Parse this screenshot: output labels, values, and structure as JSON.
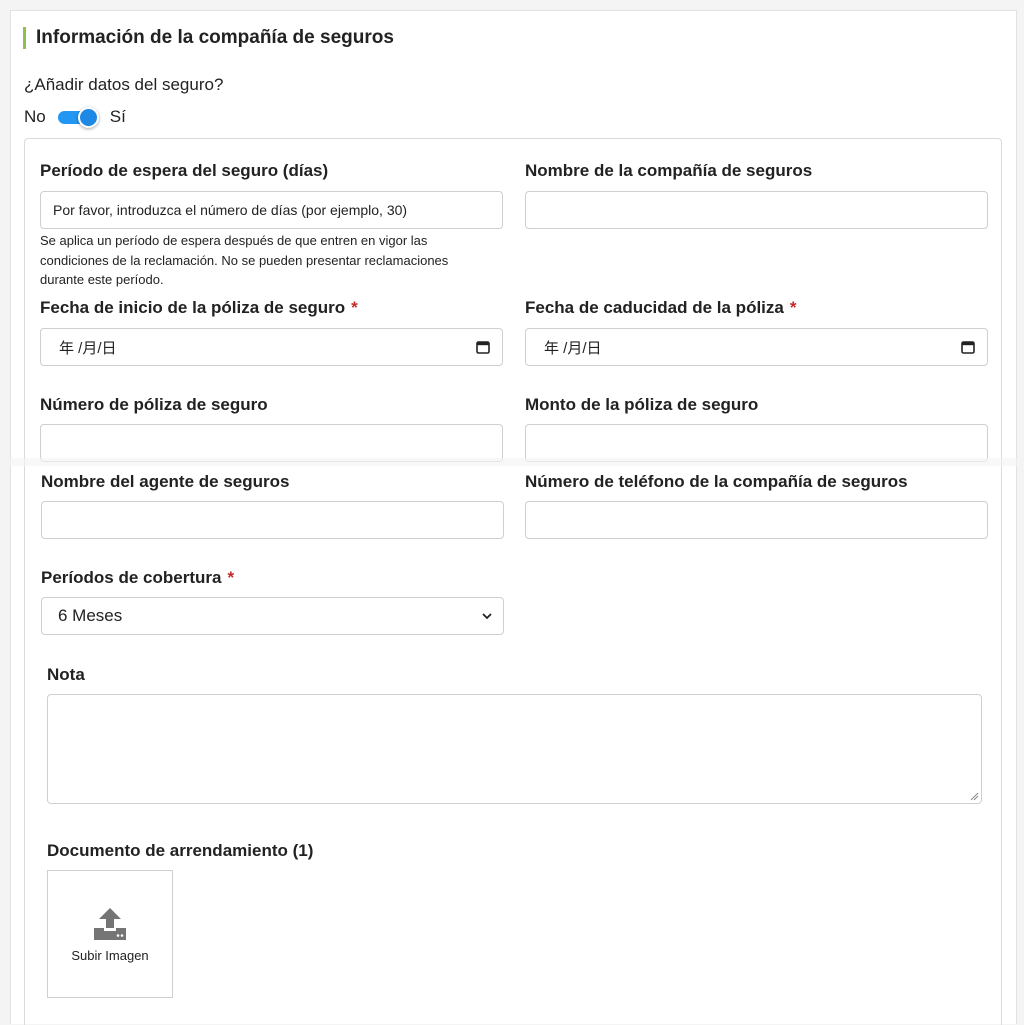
{
  "section": {
    "title": "Información de la compañía de seguros"
  },
  "toggle": {
    "question": "¿Añadir datos del seguro?",
    "off_label": "No",
    "on_label": "Sí",
    "state": "on"
  },
  "fields": {
    "waiting_period": {
      "label": "Período de espera del seguro (días)",
      "placeholder": "Por favor, introduzca el número de días (por ejemplo, 30)",
      "help": "Se aplica un período de espera después de que entren en vigor las condiciones de la reclamación. No se pueden presentar reclamaciones durante este período."
    },
    "company_name": {
      "label": "Nombre de la compañía de seguros",
      "value": ""
    },
    "start_date": {
      "label": "Fecha de inicio de la póliza de seguro",
      "required": "*",
      "mask": "年 /月/日"
    },
    "expiry_date": {
      "label": "Fecha de caducidad de la póliza",
      "required": "*",
      "mask": "年 /月/日"
    },
    "policy_number": {
      "label": "Número de póliza de seguro",
      "value": ""
    },
    "policy_amount": {
      "label": "Monto de la póliza de seguro",
      "value": ""
    },
    "agent_name": {
      "label": "Nombre del agente de seguros",
      "value": ""
    },
    "company_phone": {
      "label": "Número de teléfono de la compañía de seguros",
      "value": ""
    },
    "coverage": {
      "label": "Períodos de cobertura",
      "required": "*",
      "selected": "6 Meses"
    },
    "note": {
      "label": "Nota",
      "value": ""
    },
    "lease_document": {
      "label": "Documento de arrendamiento (1)",
      "upload_label": "Subir Imagen"
    }
  },
  "colors": {
    "accent_bar": "#8bc34a",
    "toggle": "#2196f3",
    "required": "#c62828",
    "border": "#cfcfcf"
  },
  "icons": {
    "date": "calendar-icon",
    "select": "chevron-down-icon",
    "upload": "upload-icon",
    "resize": "resize-grip-icon"
  }
}
